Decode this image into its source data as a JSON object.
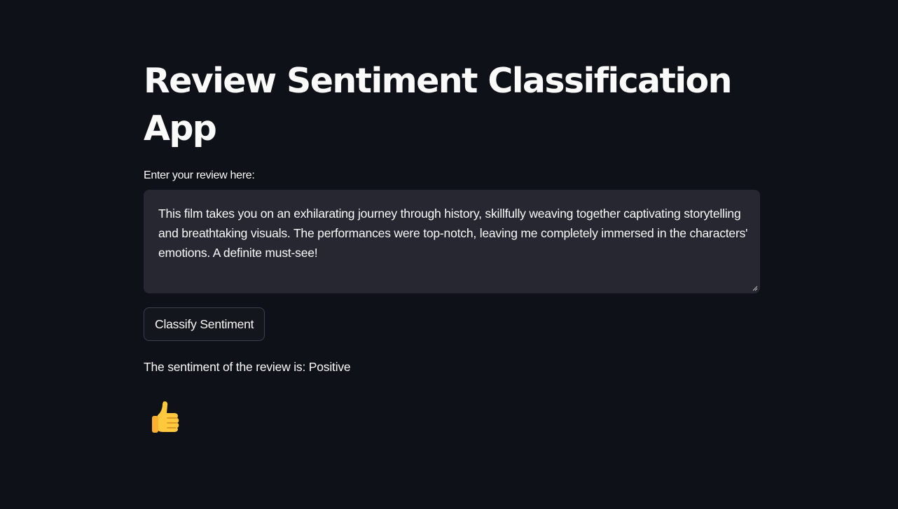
{
  "title": "Review Sentiment Classification App",
  "review_input": {
    "label": "Enter your review here:",
    "value": "This film takes you on an exhilarating journey through history, skillfully weaving together captivating storytelling and breathtaking visuals. The performances were top-notch, leaving me completely immersed in the characters' emotions. A definite must-see!"
  },
  "classify_button": {
    "label": "Classify Sentiment"
  },
  "result": {
    "text": "The sentiment of the review is: Positive",
    "icon": "thumbs-up-icon"
  },
  "colors": {
    "background": "#0e1117",
    "input_background": "#262730",
    "text": "#fafafa",
    "button_border": "#3d404a",
    "thumb": "#ffc83d"
  }
}
